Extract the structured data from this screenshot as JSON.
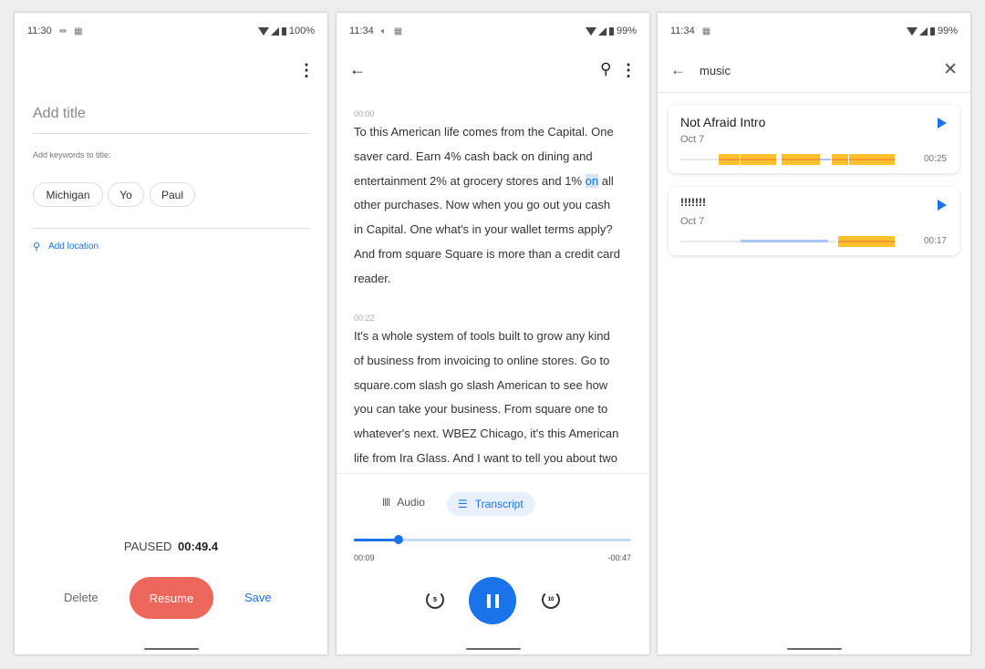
{
  "left": {
    "status": {
      "time": "11:30",
      "battery": "100%"
    },
    "title_placeholder": "Add title",
    "keywords_label": "Add keywords to title:",
    "chips": [
      "Michigan",
      "Yo",
      "Paul"
    ],
    "add_location": "Add location",
    "state": "PAUSED",
    "elapsed": "00:49.4",
    "delete": "Delete",
    "resume": "Resume",
    "save": "Save"
  },
  "middle": {
    "status": {
      "time": "11:34",
      "battery": "99%"
    },
    "segments": [
      {
        "timestamp": "00:00",
        "lines": [
          "To this American life comes from the Capital. One",
          "saver card. Earn 4% cash back on dining and",
          "entertainment 2% at grocery stores and 1% |on| all",
          "other purchases. Now when you go out you cash",
          "in Capital. One what's in your wallet terms apply?",
          "And from square Square is more than a credit card",
          "reader."
        ]
      },
      {
        "timestamp": "00:22",
        "lines": [
          "It's a whole system of tools built to grow any kind",
          "of business from invoicing to online stores. Go to",
          "square.com slash go slash American to see how",
          "you can take your business. From square one to",
          "whatever's next. WBEZ Chicago, it's this American",
          "life from Ira Glass. And I want to tell you about two"
        ]
      }
    ],
    "highlight": {
      "before": "entertainment 2% at grocery stores and 1% ",
      "word": "on",
      "after": " all"
    },
    "tabs": {
      "audio": "Audio",
      "transcript": "Transcript",
      "active": "transcript"
    },
    "progress": 0.16,
    "elapsed": "00:09",
    "remaining": "-00:47",
    "rewind": "5",
    "forward": "10",
    "accent": "#1a73e8"
  },
  "right": {
    "status": {
      "time": "11:34",
      "battery": "99%"
    },
    "query": "music",
    "results": [
      {
        "title": "Not Afraid Intro",
        "date": "Oct 7",
        "duration": "00:25"
      },
      {
        "title": "!!!!!!!",
        "date": "Oct 7",
        "duration": "00:17"
      }
    ]
  }
}
